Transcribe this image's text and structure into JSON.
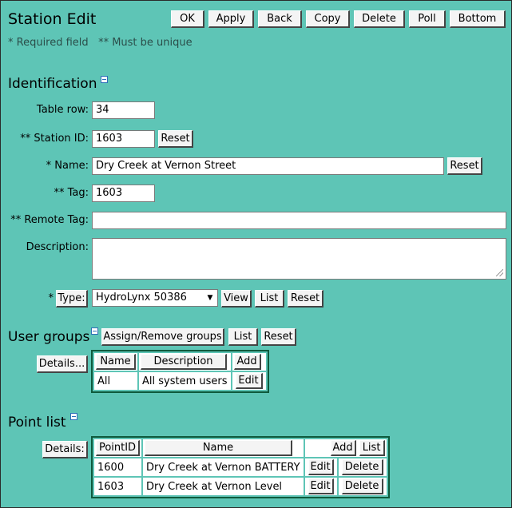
{
  "page": {
    "title": "Station Edit",
    "notes": "* Required field   ** Must be unique"
  },
  "toolbar": {
    "ok": "OK",
    "apply": "Apply",
    "back": "Back",
    "copy": "Copy",
    "delete": "Delete",
    "poll": "Poll",
    "bottom": "Bottom"
  },
  "identification": {
    "heading": "Identification",
    "table_row": {
      "label": "Table row:",
      "value": "34"
    },
    "station_id": {
      "label": "** Station ID:",
      "value": "1603",
      "reset": "Reset"
    },
    "name": {
      "label": "* Name:",
      "value": "Dry Creek at Vernon Street",
      "reset": "Reset"
    },
    "tag": {
      "label": "** Tag:",
      "value": "1603"
    },
    "remote_tag": {
      "label": "** Remote Tag:",
      "value": ""
    },
    "description": {
      "label": "Description:",
      "value": ""
    },
    "type": {
      "prefix": "*",
      "button": "Type:",
      "selected": "HydroLynx 50386",
      "view": "View",
      "list": "List",
      "reset": "Reset"
    }
  },
  "user_groups": {
    "heading": "User groups",
    "assign": "Assign/Remove groups",
    "list": "List",
    "reset": "Reset",
    "details": "Details...",
    "columns": {
      "name": "Name",
      "description": "Description",
      "add": "Add"
    },
    "rows": [
      {
        "name": "All",
        "description": "All system users",
        "edit": "Edit"
      }
    ]
  },
  "point_list": {
    "heading": "Point list",
    "details": "Details:",
    "columns": {
      "pointid": "PointID",
      "name": "Name",
      "add": "Add",
      "list": "List"
    },
    "rows": [
      {
        "pointid": "1600",
        "name": "Dry Creek at Vernon BATTERY",
        "edit": "Edit",
        "delete": "Delete"
      },
      {
        "pointid": "1603",
        "name": "Dry Creek at Vernon Level",
        "edit": "Edit",
        "delete": "Delete"
      }
    ]
  }
}
